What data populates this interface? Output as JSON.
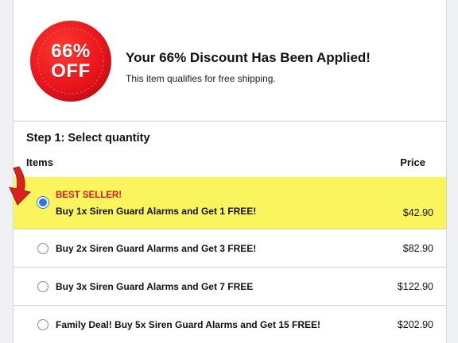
{
  "banner": {
    "seal_line1": "66%",
    "seal_line2": "OFF",
    "title": "Your 66% Discount Has Been Applied!",
    "subtitle": "This item qualifies for free shipping."
  },
  "step": {
    "title": "Step 1: Select quantity",
    "col_items": "Items",
    "col_price": "Price"
  },
  "options": [
    {
      "badge": "BEST SELLER!",
      "label": "Buy 1x Siren Guard Alarms and Get 1 FREE!",
      "price": "$42.90",
      "selected": true
    },
    {
      "label": "Buy 2x Siren Guard Alarms and Get 3 FREE!",
      "price": "$82.90",
      "selected": false
    },
    {
      "label": "Buy 3x Siren Guard Alarms and Get 7 FREE",
      "price": "$122.90",
      "selected": false
    },
    {
      "label": "Family Deal! Buy 5x Siren Guard Alarms and Get 15 FREE!",
      "price": "$202.90",
      "selected": false
    }
  ],
  "colors": {
    "seal_red": "#e8141c",
    "highlight_yellow": "#fbf55d",
    "badge_red": "#e0141e",
    "radio_selected": "#2f73e6",
    "arrow_red": "#d9221c"
  },
  "icons": {
    "seal": "discount-seal-icon",
    "arrow": "pointer-arrow-icon"
  }
}
